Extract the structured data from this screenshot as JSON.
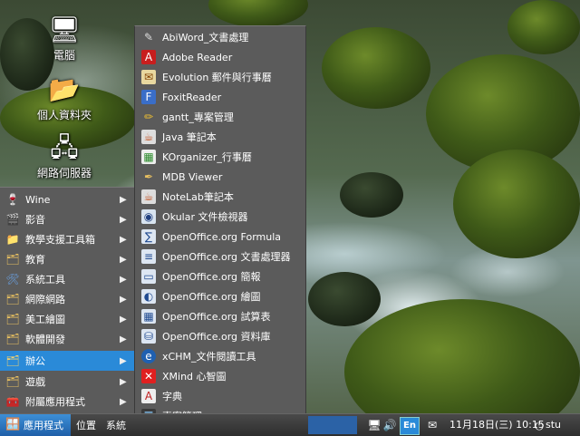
{
  "desktop_icons": [
    {
      "label": "電腦",
      "icon": "computer-icon"
    },
    {
      "label": "個人資料夾",
      "icon": "home-folder-icon"
    },
    {
      "label": "網路伺服器",
      "icon": "network-servers-icon"
    }
  ],
  "main_menu": {
    "items": [
      {
        "label": "Wine",
        "icon": "wine-icon"
      },
      {
        "label": "影音",
        "icon": "multimedia-icon"
      },
      {
        "label": "教學支援工具箱",
        "icon": "folder-icon"
      },
      {
        "label": "教育",
        "icon": "education-icon"
      },
      {
        "label": "系統工具",
        "icon": "system-tools-icon"
      },
      {
        "label": "網際網路",
        "icon": "internet-icon"
      },
      {
        "label": "美工繪圖",
        "icon": "graphics-icon"
      },
      {
        "label": "軟體開發",
        "icon": "development-icon"
      },
      {
        "label": "辦公",
        "icon": "office-icon",
        "active": true
      },
      {
        "label": "遊戲",
        "icon": "games-icon"
      },
      {
        "label": "附屬應用程式",
        "icon": "accessories-icon"
      }
    ]
  },
  "sub_menu": {
    "items": [
      {
        "label": "AbiWord_文書處理",
        "icon": "abiword-icon"
      },
      {
        "label": "Adobe Reader",
        "icon": "adobe-reader-icon"
      },
      {
        "label": "Evolution 郵件與行事曆",
        "icon": "evolution-icon"
      },
      {
        "label": "FoxitReader",
        "icon": "foxit-reader-icon"
      },
      {
        "label": "gantt_專案管理",
        "icon": "gantt-icon"
      },
      {
        "label": "Java 筆記本",
        "icon": "java-notebook-icon"
      },
      {
        "label": "KOrganizer_行事曆",
        "icon": "korganizer-icon"
      },
      {
        "label": "MDB Viewer",
        "icon": "mdb-viewer-icon"
      },
      {
        "label": "NoteLab筆記本",
        "icon": "notelab-icon"
      },
      {
        "label": "Okular 文件檢視器",
        "icon": "okular-icon"
      },
      {
        "label": "OpenOffice.org Formula",
        "icon": "ooo-formula-icon"
      },
      {
        "label": "OpenOffice.org 文書處理器",
        "icon": "ooo-writer-icon"
      },
      {
        "label": "OpenOffice.org 簡報",
        "icon": "ooo-impress-icon"
      },
      {
        "label": "OpenOffice.org 繪圖",
        "icon": "ooo-draw-icon"
      },
      {
        "label": "OpenOffice.org 試算表",
        "icon": "ooo-calc-icon"
      },
      {
        "label": "OpenOffice.org 資料庫",
        "icon": "ooo-base-icon"
      },
      {
        "label": "xCHM_文件閱讀工具",
        "icon": "xchm-icon"
      },
      {
        "label": "XMind 心智圖",
        "icon": "xmind-icon"
      },
      {
        "label": "字典",
        "icon": "dictionary-icon"
      },
      {
        "label": "專案管理",
        "icon": "project-manager-icon"
      }
    ]
  },
  "panel": {
    "applications_label": "應用程式",
    "places_label": "位置",
    "system_label": "系統",
    "input_method_label": "En",
    "clock": "11月18日(三) 10:15",
    "user": "stu"
  },
  "colors": {
    "menu_bg": "#5b5b5b",
    "highlight": "#2a8ad8",
    "panel_bg": "#3a3a3a"
  }
}
